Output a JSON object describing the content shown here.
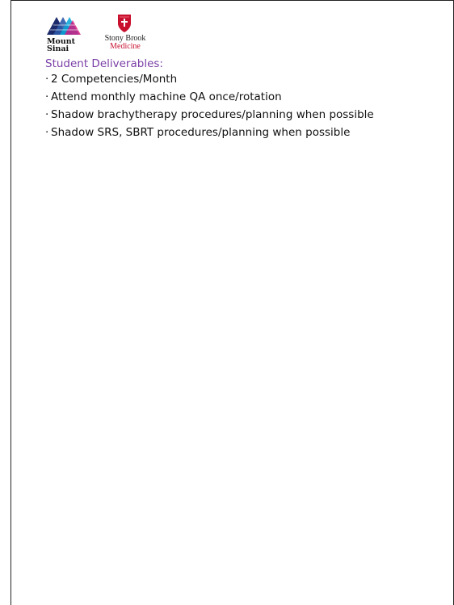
{
  "logos": {
    "mount_sinai": {
      "text": "Mount\nSinai",
      "icon": "mount-sinai-logo-icon",
      "colors": [
        "#1b2a6b",
        "#06a3d6",
        "#d6137a"
      ]
    },
    "stony_brook": {
      "line1": "Stony Brook",
      "line2": "Medicine",
      "icon": "stony-brook-shield-icon",
      "color": "#c8102e"
    }
  },
  "content": {
    "heading": "Student Deliverables:",
    "heading_color": "#7a3fa6",
    "bullet": "·",
    "items": [
      "2 Competencies/Month",
      "Attend monthly machine QA once/rotation",
      "Shadow brachytherapy procedures/planning when possible",
      "Shadow SRS, SBRT procedures/planning when possible"
    ]
  }
}
